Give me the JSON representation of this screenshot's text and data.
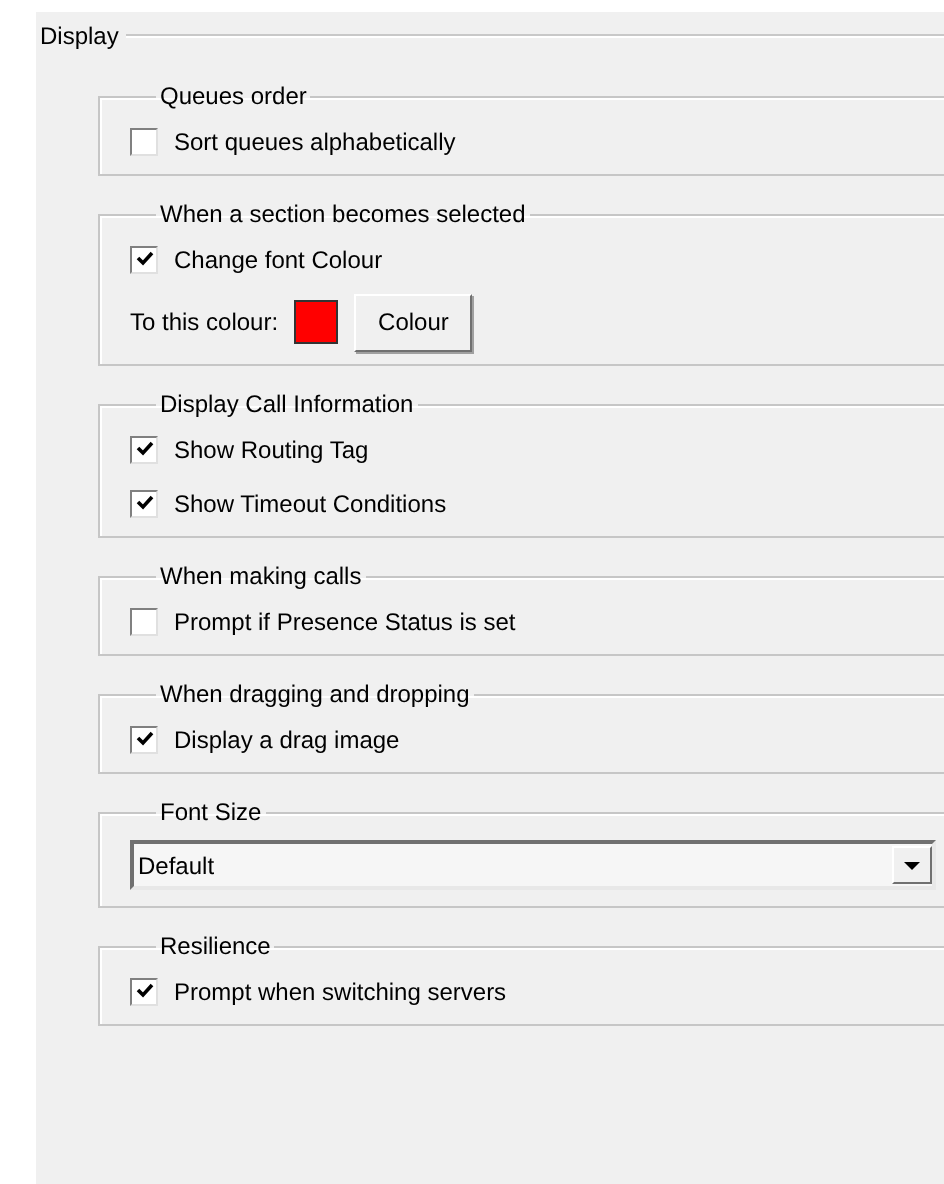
{
  "section": {
    "title": "Display"
  },
  "groups": [
    {
      "title": "Queues order",
      "items": [
        {
          "kind": "checkbox",
          "label": "Sort queues alphabetically",
          "checked": false
        }
      ]
    },
    {
      "title": "When a section becomes selected",
      "items": [
        {
          "kind": "checkbox",
          "label": "Change font Colour",
          "checked": true
        },
        {
          "kind": "color",
          "label": "To this colour:",
          "color": "#ff0000",
          "button": "Colour"
        }
      ]
    },
    {
      "title": "Display Call Information",
      "items": [
        {
          "kind": "checkbox",
          "label": "Show Routing Tag",
          "checked": true
        },
        {
          "kind": "checkbox",
          "label": "Show Timeout Conditions",
          "checked": true
        }
      ]
    },
    {
      "title": "When making calls",
      "items": [
        {
          "kind": "checkbox",
          "label": "Prompt if Presence Status is set",
          "checked": false
        }
      ]
    },
    {
      "title": "When dragging and dropping",
      "items": [
        {
          "kind": "checkbox",
          "label": "Display a drag image",
          "checked": true
        }
      ]
    },
    {
      "title": "Font Size",
      "items": [
        {
          "kind": "dropdown",
          "value": "Default"
        }
      ]
    },
    {
      "title": "Resilience",
      "items": [
        {
          "kind": "checkbox",
          "label": "Prompt when switching servers",
          "checked": true
        }
      ]
    }
  ]
}
